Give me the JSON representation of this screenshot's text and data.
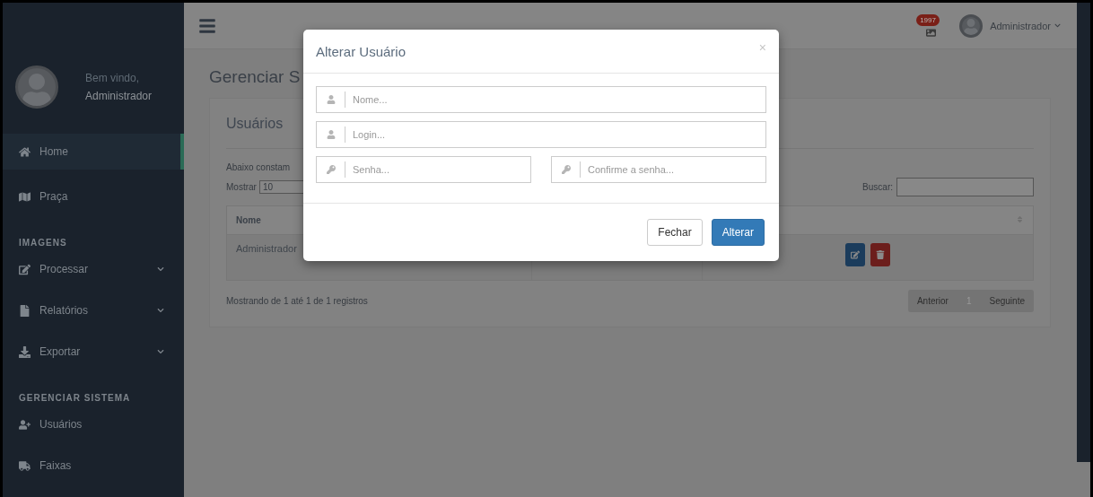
{
  "sidebar": {
    "welcome": "Bem vindo,",
    "user": "Administrador",
    "sections": [
      {
        "items": [
          {
            "label": "Home",
            "selected": true,
            "expandable": false
          },
          {
            "label": "Praça",
            "selected": false,
            "expandable": false
          }
        ]
      },
      {
        "title": "IMAGENS",
        "items": [
          {
            "label": "Processar",
            "selected": false,
            "expandable": true
          },
          {
            "label": "Relatórios",
            "selected": false,
            "expandable": true
          },
          {
            "label": "Exportar",
            "selected": false,
            "expandable": true
          }
        ]
      },
      {
        "title": "GERENCIAR SISTEMA",
        "items": [
          {
            "label": "Usuários",
            "selected": false,
            "expandable": false
          },
          {
            "label": "Faixas",
            "selected": false,
            "expandable": false
          }
        ]
      }
    ]
  },
  "topbar": {
    "notification_count": "1997",
    "user": "Administrador"
  },
  "page": {
    "title": "Gerenciar S",
    "card": {
      "title": "Usuários",
      "description": "Abaixo constam",
      "show_label": "Mostrar",
      "page_size": "10",
      "search_label": "Buscar:",
      "table": {
        "columns": [
          "Nome"
        ],
        "rows": [
          {
            "name": "Administrador"
          }
        ]
      },
      "info": "Mostrando de 1 até 1 de 1 registros",
      "pagination": {
        "previous": "Anterior",
        "pages": [
          {
            "label": "1",
            "selected": true
          }
        ],
        "next": "Seguinte"
      }
    }
  },
  "modal": {
    "title": "Alterar Usuário",
    "close": "×",
    "rows": [
      {
        "fields": [
          {
            "placeholder": "Nome...",
            "kind": "user"
          }
        ]
      },
      {
        "fields": [
          {
            "placeholder": "Login...",
            "kind": "user"
          }
        ]
      },
      {
        "fields": [
          {
            "placeholder": "Senha...",
            "kind": "key"
          },
          {
            "placeholder": "Confirme a senha...",
            "kind": "key"
          }
        ]
      }
    ],
    "buttons": [
      {
        "label": "Fechar",
        "kind": "default"
      },
      {
        "label": "Alterar",
        "kind": "primary"
      }
    ]
  }
}
